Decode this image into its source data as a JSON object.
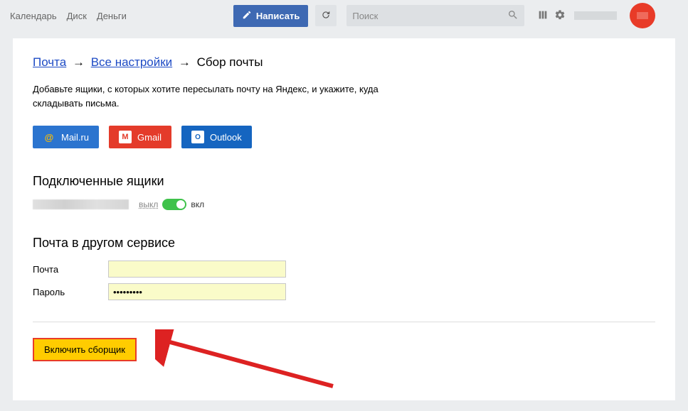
{
  "topnav": {
    "links": [
      "Календарь",
      "Диск",
      "Деньги"
    ],
    "compose": "Написать",
    "search_placeholder": "Поиск"
  },
  "breadcrumb": {
    "mail": "Почта",
    "all_settings": "Все настройки",
    "current": "Сбор почты"
  },
  "description": "Добавьте ящики, с которых хотите пересылать почту на Яндекс, и укажите, куда складывать письма.",
  "providers": {
    "mailru": "Mail.ru",
    "gmail": "Gmail",
    "outlook": "Outlook"
  },
  "connected": {
    "heading": "Подключенные ящики",
    "off": "выкл",
    "on": "вкл"
  },
  "other_service": {
    "heading": "Почта в другом сервисе",
    "email_label": "Почта",
    "email_value": "",
    "password_label": "Пароль",
    "password_value": "•••••••••"
  },
  "submit": "Включить сборщик"
}
